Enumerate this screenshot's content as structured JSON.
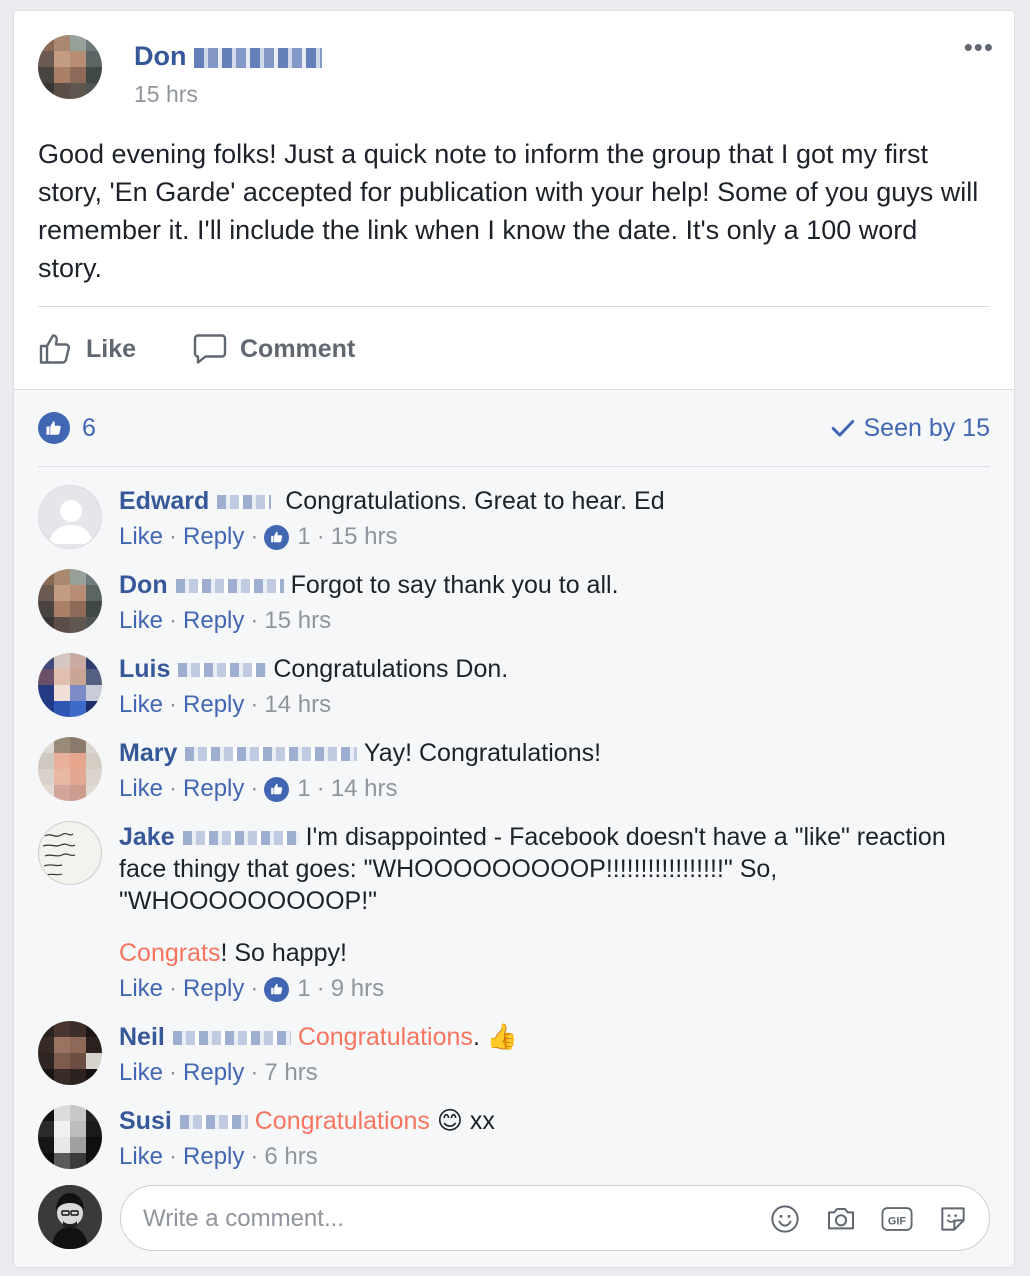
{
  "post": {
    "author_first": "Don",
    "timestamp": "15 hrs",
    "text": "Good evening folks! Just a quick note to inform the group that I got my first story, 'En Garde' accepted for publication with your help! Some of you guys will remember it. I'll include the link when I know the date. It's only a 100 word story.",
    "actions": {
      "like": "Like",
      "comment": "Comment"
    },
    "likes_count": "6",
    "seen_by": "Seen by 15"
  },
  "comments": [
    {
      "name": "Edward",
      "text": "Congratulations. Great to hear. Ed",
      "like": "Like",
      "reply": "Reply",
      "likes": "1",
      "time": "15 hrs"
    },
    {
      "name": "Don",
      "text": "Forgot to say thank you to all.",
      "like": "Like",
      "reply": "Reply",
      "time": "15 hrs"
    },
    {
      "name": "Luis",
      "text": "Congratulations Don.",
      "like": "Like",
      "reply": "Reply",
      "time": "14 hrs"
    },
    {
      "name": "Mary",
      "text": "Yay! Congratulations!",
      "like": "Like",
      "reply": "Reply",
      "likes": "1",
      "time": "14 hrs"
    },
    {
      "name": "Jake",
      "text": "I'm disappointed - Facebook doesn't have a \"like\" reaction face thingy that goes: \"WHOOOOOOOOOP!!!!!!!!!!!!!!!!!\" So, \"WHOOOOOOOOOP!\"",
      "tag": "Congrats",
      "text2": "! So happy!",
      "like": "Like",
      "reply": "Reply",
      "likes": "1",
      "time": "9 hrs"
    },
    {
      "name": "Neil",
      "tag": "Congratulations",
      "text": ".",
      "emoji": "👍",
      "like": "Like",
      "reply": "Reply",
      "time": "7 hrs"
    },
    {
      "name": "Susi",
      "tag": "Congratulations",
      "emoji": "😊",
      "text": "xx",
      "like": "Like",
      "reply": "Reply",
      "time": "6 hrs"
    }
  ],
  "composer": {
    "placeholder": "Write a comment...",
    "icons": [
      "emoji-icon",
      "camera-icon",
      "gif-icon",
      "sticker-icon"
    ]
  },
  "colors": {
    "link": "#365899",
    "accent": "#4267b2",
    "tag": "#f7745e",
    "muted": "#90949c"
  }
}
